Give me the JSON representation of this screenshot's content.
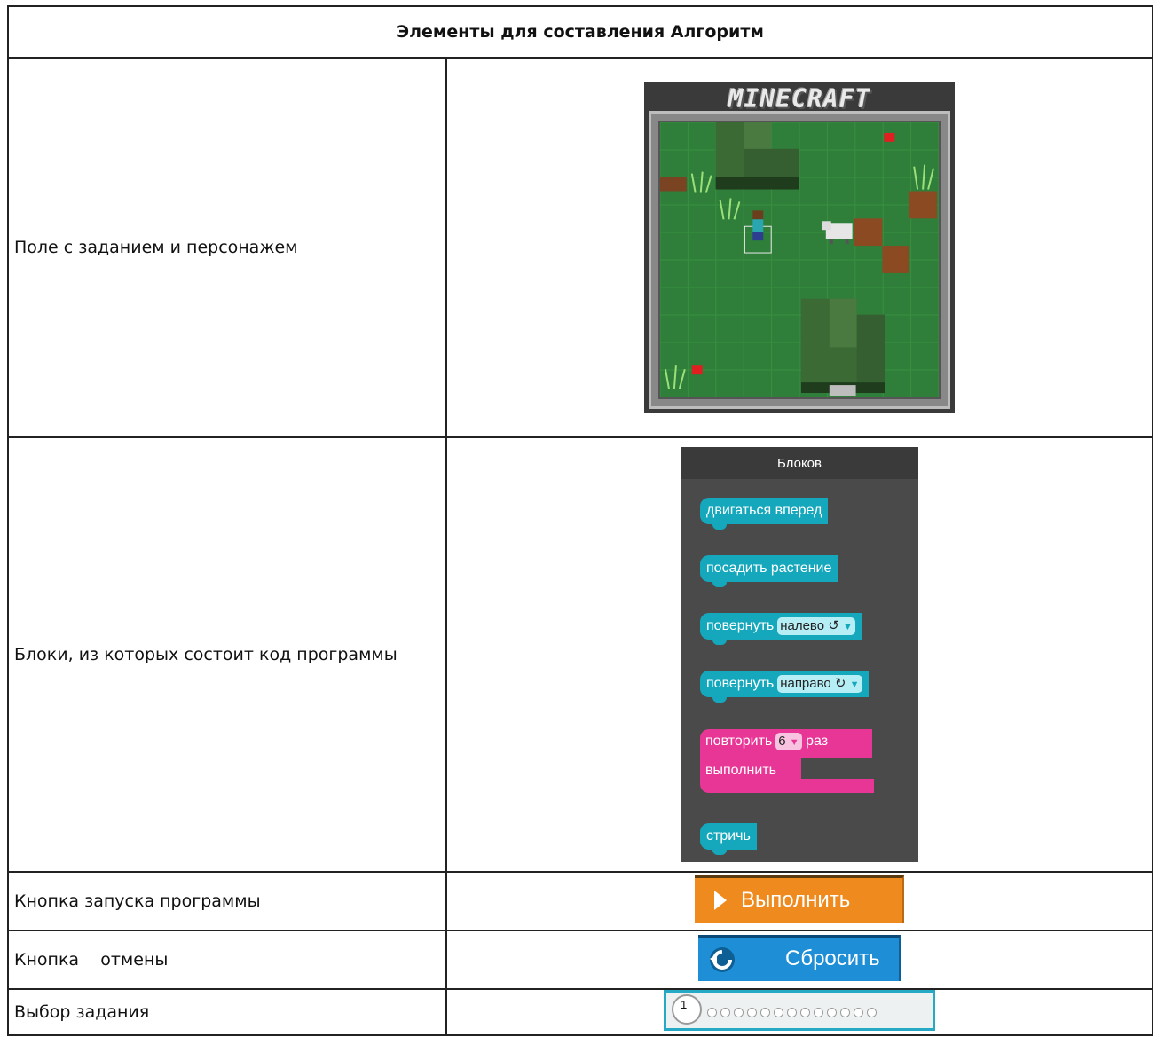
{
  "table": {
    "header": "Элементы для составления Алгоритм",
    "rows": [
      {
        "label": "Поле с заданием и персонажем"
      },
      {
        "label": "Блоки, из которых состоит код программы"
      },
      {
        "label": "Кнопка запуска программы"
      },
      {
        "label": "Кнопка    отмены"
      },
      {
        "label": "Выбор задания"
      }
    ]
  },
  "game": {
    "logo": "MINECRAFT",
    "grass_color": "#2e7d3a",
    "dirt_color": "#8b4a22"
  },
  "palette": {
    "title": "Блоков",
    "blocks": [
      {
        "text": "двигаться вперед"
      },
      {
        "text": "посадить растение"
      },
      {
        "text": "повернуть",
        "option": "налево ↺"
      },
      {
        "text": "повернуть",
        "option": "направо ↻"
      },
      {
        "text": "стричь"
      }
    ],
    "repeat": {
      "prefix": "повторить",
      "count": "6",
      "suffix": "раз",
      "body_label": "выполнить"
    },
    "colors": {
      "action": "#15a8bd",
      "loop": "#e83696"
    }
  },
  "buttons": {
    "run_label": "Выполнить",
    "reset_label": "Сбросить",
    "run_color": "#ee8a1e",
    "reset_color": "#1e8fd6"
  },
  "levels": {
    "current": "1",
    "total_dots": 13
  }
}
